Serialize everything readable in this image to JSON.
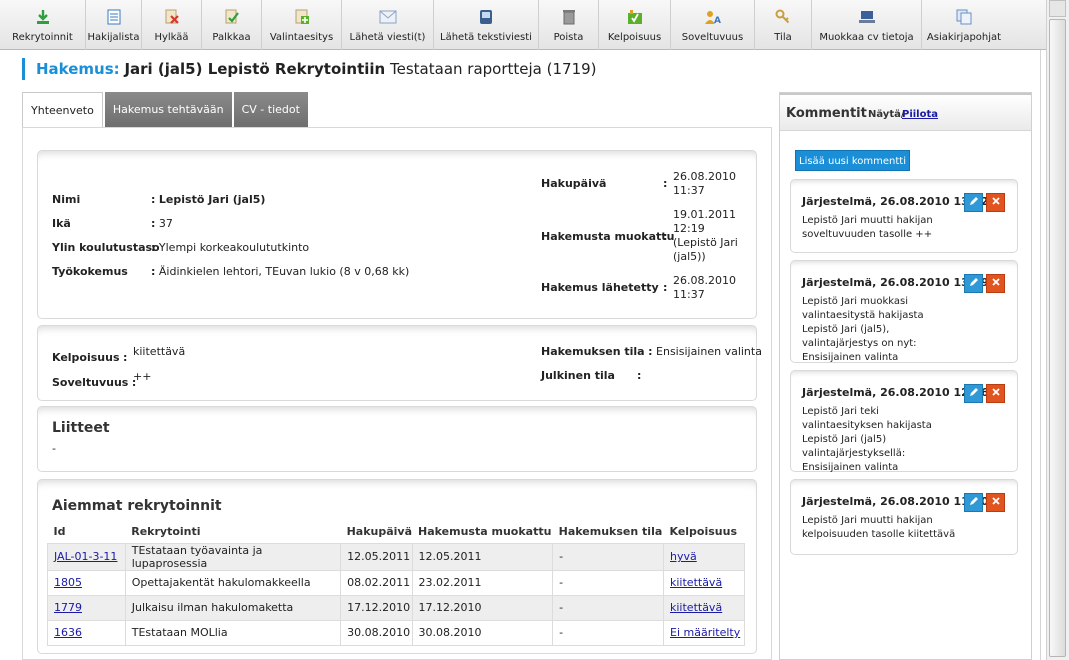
{
  "toolbar": {
    "buttons": [
      {
        "label": "Rekrytoinnit",
        "icon": "download-icon",
        "color": "#2e9e3e"
      },
      {
        "label": "Hakijalista",
        "icon": "list-icon",
        "color": "#3b78c4"
      },
      {
        "label": "Hylkää",
        "icon": "reject-icon",
        "color": "#d23a2a"
      },
      {
        "label": "Palkkaa",
        "icon": "hire-icon",
        "color": "#e0a020"
      },
      {
        "label": "Valintaesitys",
        "icon": "proposal-icon",
        "color": "#5bb02b"
      },
      {
        "label": "Lähetä viesti(t)",
        "icon": "mail-icon",
        "color": "#8aa3c4"
      },
      {
        "label": "Lähetä tekstiviesti",
        "icon": "phone-icon",
        "color": "#3a5f8f"
      },
      {
        "label": "Poista",
        "icon": "trash-icon",
        "color": "#7a7a7a"
      },
      {
        "label": "Kelpoisuus",
        "icon": "qualification-icon",
        "color": "#5bb02b"
      },
      {
        "label": "Soveltuvuus",
        "icon": "suitability-icon",
        "color": "#e0a020"
      },
      {
        "label": "Tila",
        "icon": "key-icon",
        "color": "#c8a040"
      },
      {
        "label": "Muokkaa cv tietoja",
        "icon": "laptop-icon",
        "color": "#3b5f9a"
      },
      {
        "label": "Asiakirjapohjat",
        "icon": "documents-icon",
        "color": "#6a8ec4"
      }
    ]
  },
  "heading": {
    "lead": "Hakemus:",
    "name": "Jari (jal5) Lepistö Rekrytointiin",
    "rest": "Testataan raportteja (1719)"
  },
  "tabs": [
    "Yhteenveto",
    "Hakemus tehtävään",
    "CV - tiedot"
  ],
  "summary": {
    "name_label": "Nimi",
    "name_value": "Lepistö Jari (jal5)",
    "age_label": "Ikä",
    "age_value": "37",
    "edu_label": "Ylin koulutustaso",
    "edu_value": "Ylempi korkeakoulututkinto",
    "exp_label": "Työkokemus",
    "exp_value": "Äidinkielen lehtori, TEuvan lukio (8 v 0,68 kk)",
    "applied_label": "Hakupäivä",
    "applied_value_1": "26.08.2010",
    "applied_value_2": "11:37",
    "modified_label": "Hakemusta muokattu",
    "modified_value_1": "19.01.2011",
    "modified_value_2": "12:19",
    "modified_value_3": "(Lepistö Jari",
    "modified_value_4": "(jal5))",
    "sent_label": "Hakemus lähetetty",
    "sent_value_1": "26.08.2010",
    "sent_value_2": "11:37"
  },
  "status": {
    "qual_label": "Kelpoisuus",
    "qual_value": "kiitettävä",
    "suit_label": "Soveltuvuus",
    "suit_value": "++",
    "app_status_label": "Hakemuksen tila",
    "app_status_value": "Ensisijainen valinta",
    "public_label": "Julkinen tila",
    "public_value": ""
  },
  "attachments": {
    "title": "Liitteet",
    "value": "-"
  },
  "previous": {
    "title": "Aiemmat rekrytoinnit",
    "columns": [
      "Id",
      "Rekrytointi",
      "Hakupäivä",
      "Hakemusta muokattu",
      "Hakemuksen tila",
      "Kelpoisuus"
    ],
    "rows": [
      {
        "id": "JAL-01-3-11",
        "name": "TEstataan työavainta ja lupaprosessia",
        "applied": "12.05.2011",
        "modified": "12.05.2011",
        "state": "-",
        "qual": "hyvä"
      },
      {
        "id": "1805",
        "name": "Opettajakentät hakulomakkeella",
        "applied": "08.02.2011",
        "modified": "23.02.2011",
        "state": "-",
        "qual": "kiitettävä"
      },
      {
        "id": "1779",
        "name": "Julkaisu ilman hakulomaketta",
        "applied": "17.12.2010",
        "modified": "17.12.2010",
        "state": "-",
        "qual": "kiitettävä"
      },
      {
        "id": "1636",
        "name": "TEstataan MOLlia",
        "applied": "30.08.2010",
        "modified": "30.08.2010",
        "state": "-",
        "qual": "Ei määritelty"
      }
    ]
  },
  "comments": {
    "title": "Kommentit",
    "show_label": "Näytä/",
    "hide_label": "Piilota",
    "add_label": "Lisää uusi kommentti",
    "items": [
      {
        "title": "Järjestelmä, 26.08.2010 13:12",
        "text": "Lepistö Jari muutti hakijan soveltuvuuden tasolle ++"
      },
      {
        "title": "Järjestelmä, 26.08.2010 13:09",
        "text": "Lepistö Jari muokkasi valintaesitystä hakijasta Lepistö Jari (jal5), valintajärjestys on nyt: Ensisijainen valinta"
      },
      {
        "title": "Järjestelmä, 26.08.2010 12:46",
        "text": "Lepistö Jari teki valintaesityksen hakijasta Lepistö Jari (jal5) valintajärjestyksellä: Ensisijainen valinta"
      },
      {
        "title": "Järjestelmä, 26.08.2010 11:50",
        "text": "Lepistö Jari muutti hakijan kelpoisuuden tasolle kiitettävä"
      }
    ]
  }
}
